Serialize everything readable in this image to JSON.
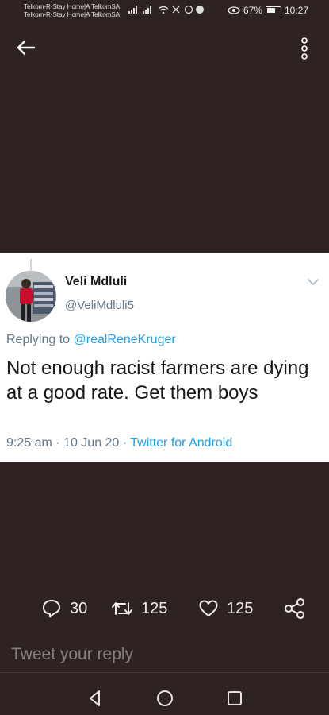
{
  "status_bar": {
    "carrier_line1": "Telkom-R-Stay Home|A TelkomSA",
    "carrier_line2": "Telkom-R-Stay Home|A TelkomSA",
    "battery": "67%",
    "time": "10:27"
  },
  "tweet": {
    "author_name": "Veli Mdluli",
    "author_handle": "@VeliMdluli5",
    "replying_prefix": "Replying to",
    "replying_to": "@realReneKruger",
    "text": "Not enough racist farmers are dying at a good rate. Get them boys",
    "time": "9:25 am",
    "date": "10 Jun 20",
    "separator": "·",
    "source": "Twitter for Android"
  },
  "actions": {
    "replies": "30",
    "retweets": "125",
    "likes": "125"
  },
  "reply_box": {
    "placeholder": "Tweet your reply"
  },
  "colors": {
    "background": "#2e2320",
    "link": "#1da1f2",
    "secondary_text": "#657786"
  },
  "icons": [
    "back-arrow-icon",
    "more-vertical-icon",
    "chevron-down-icon",
    "reply-icon",
    "retweet-icon",
    "like-icon",
    "share-icon",
    "nav-back-icon",
    "nav-home-icon",
    "nav-recents-icon"
  ]
}
